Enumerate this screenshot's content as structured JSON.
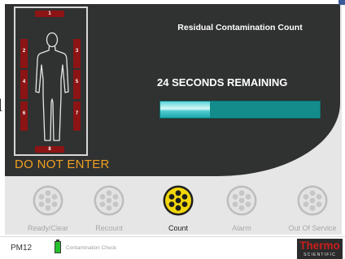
{
  "header": {
    "title": "Residual Contamination Count"
  },
  "countdown": {
    "text": "24 SECONDS REMAINING",
    "progress_fraction": 0.31
  },
  "body_diagram": {
    "detectors": [
      "1",
      "2",
      "3",
      "4",
      "5",
      "6",
      "7",
      "8"
    ],
    "warning": "DO NOT  ENTER"
  },
  "modes": [
    {
      "label": "Ready/Clear",
      "active": false
    },
    {
      "label": "Recount",
      "active": false
    },
    {
      "label": "Count",
      "active": true
    },
    {
      "label": "Alarm",
      "active": false
    },
    {
      "label": "Out Of Service",
      "active": false
    }
  ],
  "status_bar": {
    "device": "PM12",
    "battery_status": "Contamination Check",
    "brand_main": "Thermo",
    "brand_sub": "SCIENTIFIC"
  },
  "colors": {
    "panel": "#303131",
    "detector": "#8c1414",
    "warning": "#f0a020",
    "progress_track": "#148c8c",
    "active_icon": "#f2d60a",
    "inactive_icon": "#bfbfbf",
    "brand_red": "#cc1d1d"
  },
  "icons": [
    "person-silhouette-icon",
    "mode-dots-icon",
    "battery-icon"
  ]
}
